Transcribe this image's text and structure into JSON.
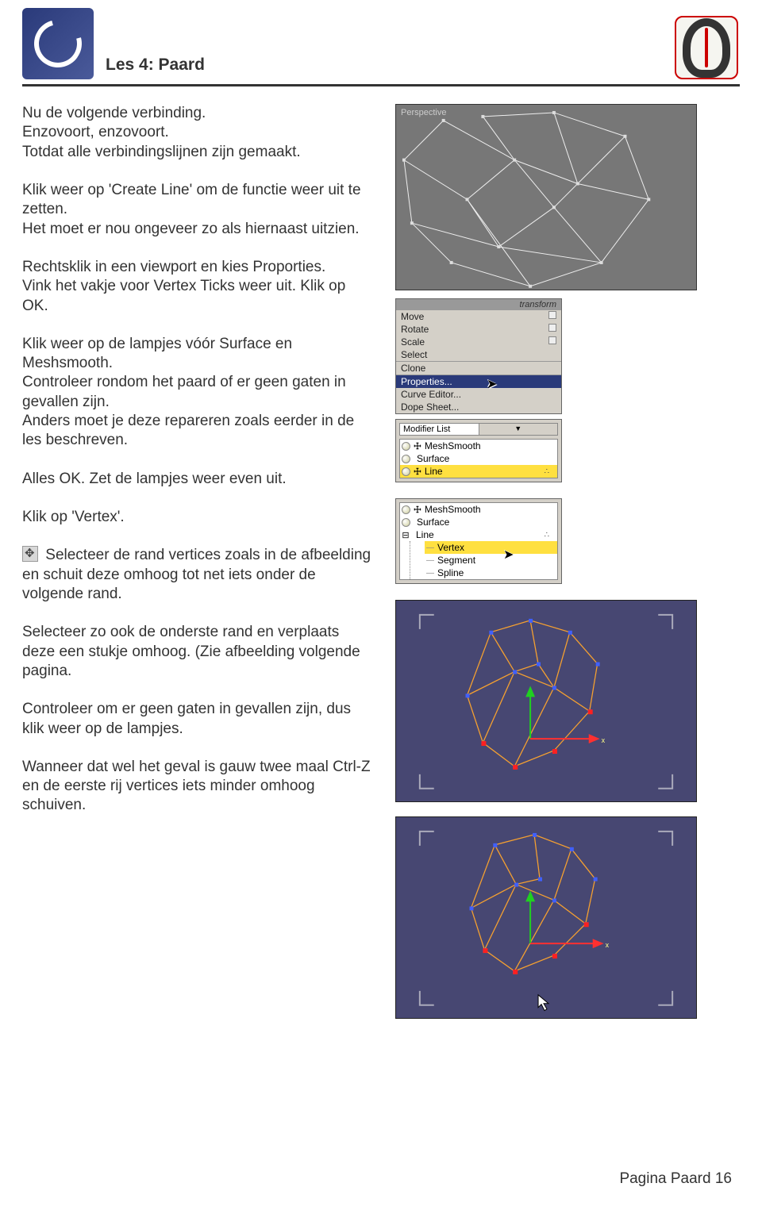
{
  "header": {
    "lesson_title": "Les 4: Paard"
  },
  "text": {
    "p1_l1": "Nu de volgende verbinding.",
    "p1_l2": "Enzovoort, enzovoort.",
    "p1_l3": "Totdat alle verbindingslijnen zijn gemaakt.",
    "p2": "Klik weer op 'Create Line' om de functie weer uit te zetten.",
    "p3": "Het moet er nou ongeveer zo als hiernaast uitzien.",
    "p4": "Rechtsklik in een viewport en kies Proporties.",
    "p5": "Vink het vakje voor Vertex Ticks weer uit. Klik op OK.",
    "p6": "Klik weer op de lampjes vóór Surface en Meshsmooth.",
    "p7": "Controleer rondom het paard of er geen gaten in gevallen zijn.",
    "p8": "Anders moet je deze repareren zoals eerder in de les beschreven.",
    "p9": "Alles OK. Zet de lampjes weer even uit.",
    "p10": "Klik op 'Vertex'.",
    "p11": "Selecteer de rand vertices zoals in de afbeelding en schuit deze omhoog tot net iets onder de volgende rand.",
    "p12": "Selecteer zo ook de onderste rand en verplaats deze een stukje omhoog. (Zie afbeelding volgende pagina.",
    "p13": "Controleer om er geen gaten in gevallen zijn, dus klik weer op de lampjes.",
    "p14": "Wanneer dat wel het geval is gauw twee maal Ctrl-Z en de eerste rij vertices iets minder omhoog schuiven."
  },
  "viewport": {
    "label": "Perspective"
  },
  "context_menu": {
    "section": "transform",
    "items": [
      {
        "label": "Move",
        "box": true
      },
      {
        "label": "Rotate",
        "box": true
      },
      {
        "label": "Scale",
        "box": true
      },
      {
        "label": "Select",
        "box": false
      },
      {
        "label": "Clone",
        "box": false
      },
      {
        "label": "Properties...",
        "box": false,
        "hi": true
      },
      {
        "label": "Curve Editor...",
        "box": false
      },
      {
        "label": "Dope Sheet...",
        "box": false
      }
    ]
  },
  "modifier_panel_1": {
    "dropdown": "Modifier List",
    "rows": [
      {
        "icon": "bulb",
        "plus": true,
        "label": "MeshSmooth"
      },
      {
        "icon": "bulb",
        "plus": false,
        "label": "Surface"
      },
      {
        "icon": "bulb",
        "plus": true,
        "label": "Line",
        "hi": true,
        "dots": true
      }
    ]
  },
  "modifier_panel_2": {
    "rows": [
      {
        "icon": "bulb",
        "plus": true,
        "label": "MeshSmooth"
      },
      {
        "icon": "bulb",
        "plus": false,
        "label": "Surface"
      },
      {
        "icon": "minus",
        "plus": false,
        "label": "Line",
        "dots": true
      }
    ],
    "subitems": [
      {
        "label": "Vertex",
        "hi": true
      },
      {
        "label": "Segment"
      },
      {
        "label": "Spline"
      }
    ]
  },
  "footer": {
    "page": "Pagina Paard 16"
  }
}
